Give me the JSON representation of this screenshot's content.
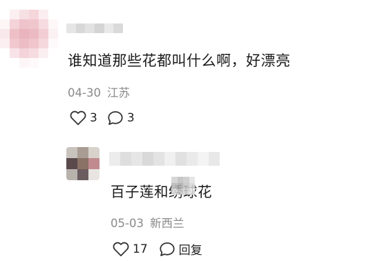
{
  "comment": {
    "avatar": "pixelated-avatar",
    "text": "谁知道那些花都叫什么啊，好漂亮",
    "date": "04-30",
    "location": "江苏",
    "likes": "3",
    "replies": "3",
    "icons": {
      "like": "heart-icon",
      "reply": "speech-bubble-icon"
    }
  },
  "reply": {
    "avatar": "pixelated-avatar",
    "text": "百子莲和绣球花",
    "date": "05-03",
    "location": "新西兰",
    "likes": "17",
    "reply_label": "回复",
    "icons": {
      "like": "heart-icon",
      "reply": "speech-bubble-icon"
    }
  },
  "colors": {
    "meta_gray": "#8a8a8a",
    "text": "#1a1a1a",
    "avatar_pink": "#f2c9cf",
    "blur_gray": "#dcdcdc"
  }
}
